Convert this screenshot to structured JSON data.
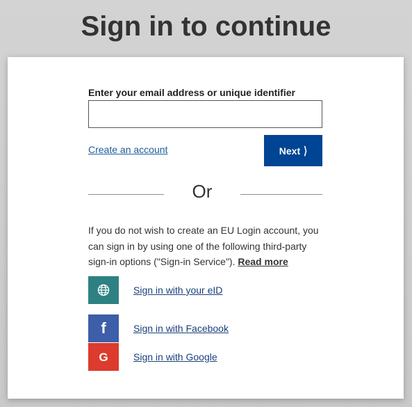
{
  "page": {
    "title": "Sign in to continue"
  },
  "login": {
    "email_label": "Enter your email address or unique identifier",
    "email_value": "",
    "email_placeholder": "",
    "create_account_label": "Create an account",
    "next_label": "Next",
    "or_label": "Or"
  },
  "third_party": {
    "info_text": "If you do not wish to create an EU Login account, you can sign in by using one of the following third-party sign-in options (\"Sign-in Service\").",
    "read_more_label": "Read more",
    "providers": [
      {
        "label": "Sign in with your eID",
        "icon": "globe-icon",
        "color": "#2e8183"
      },
      {
        "label": "Sign in with Facebook",
        "icon": "facebook-icon",
        "color": "#3d5ea8"
      },
      {
        "label": "Sign in with Google",
        "icon": "google-icon",
        "color": "#dc3b2d"
      }
    ]
  },
  "colors": {
    "primary_button": "#004494",
    "link": "#1a5c9c"
  }
}
